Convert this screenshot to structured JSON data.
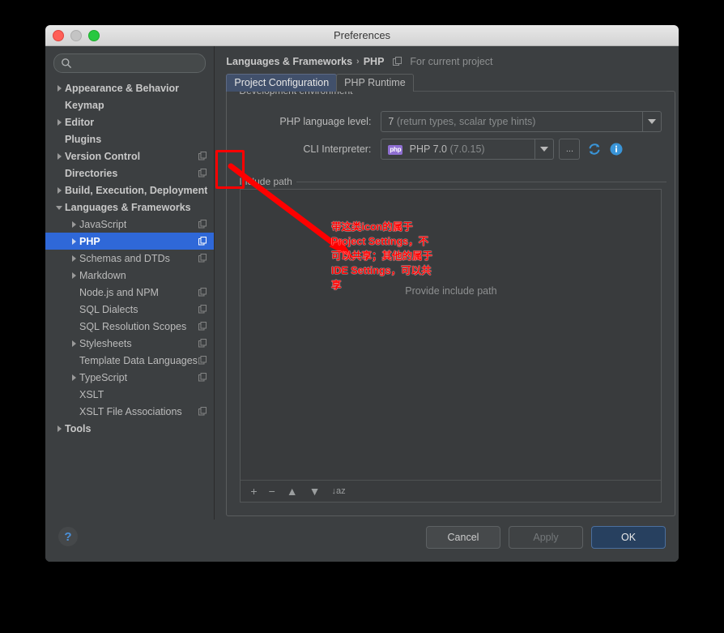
{
  "window": {
    "title": "Preferences",
    "traffic_lights": [
      "close-light",
      "minimize-light",
      "zoom-light"
    ]
  },
  "sidebar": {
    "search": {
      "value": "",
      "placeholder": ""
    },
    "items": [
      {
        "label": "Appearance & Behavior",
        "indent": 0,
        "arrow": "collapsed",
        "bold": true,
        "copy_icon": false,
        "selected": false
      },
      {
        "label": "Keymap",
        "indent": 0,
        "arrow": "none",
        "bold": true,
        "copy_icon": false,
        "selected": false
      },
      {
        "label": "Editor",
        "indent": 0,
        "arrow": "collapsed",
        "bold": true,
        "copy_icon": false,
        "selected": false
      },
      {
        "label": "Plugins",
        "indent": 0,
        "arrow": "none",
        "bold": true,
        "copy_icon": false,
        "selected": false
      },
      {
        "label": "Version Control",
        "indent": 0,
        "arrow": "collapsed",
        "bold": true,
        "copy_icon": true,
        "selected": false
      },
      {
        "label": "Directories",
        "indent": 0,
        "arrow": "none",
        "bold": true,
        "copy_icon": true,
        "selected": false
      },
      {
        "label": "Build, Execution, Deployment",
        "indent": 0,
        "arrow": "collapsed",
        "bold": true,
        "copy_icon": false,
        "selected": false
      },
      {
        "label": "Languages & Frameworks",
        "indent": 0,
        "arrow": "expanded",
        "bold": true,
        "copy_icon": false,
        "selected": false
      },
      {
        "label": "JavaScript",
        "indent": 1,
        "arrow": "collapsed",
        "bold": false,
        "copy_icon": true,
        "selected": false
      },
      {
        "label": "PHP",
        "indent": 1,
        "arrow": "collapsed",
        "bold": true,
        "copy_icon": true,
        "selected": true
      },
      {
        "label": "Schemas and DTDs",
        "indent": 1,
        "arrow": "collapsed",
        "bold": false,
        "copy_icon": true,
        "selected": false
      },
      {
        "label": "Markdown",
        "indent": 1,
        "arrow": "collapsed",
        "bold": false,
        "copy_icon": false,
        "selected": false
      },
      {
        "label": "Node.js and NPM",
        "indent": 1,
        "arrow": "none",
        "bold": false,
        "copy_icon": true,
        "selected": false
      },
      {
        "label": "SQL Dialects",
        "indent": 1,
        "arrow": "none",
        "bold": false,
        "copy_icon": true,
        "selected": false
      },
      {
        "label": "SQL Resolution Scopes",
        "indent": 1,
        "arrow": "none",
        "bold": false,
        "copy_icon": true,
        "selected": false
      },
      {
        "label": "Stylesheets",
        "indent": 1,
        "arrow": "collapsed",
        "bold": false,
        "copy_icon": true,
        "selected": false
      },
      {
        "label": "Template Data Languages",
        "indent": 1,
        "arrow": "none",
        "bold": false,
        "copy_icon": true,
        "selected": false
      },
      {
        "label": "TypeScript",
        "indent": 1,
        "arrow": "collapsed",
        "bold": false,
        "copy_icon": true,
        "selected": false
      },
      {
        "label": "XSLT",
        "indent": 1,
        "arrow": "none",
        "bold": false,
        "copy_icon": false,
        "selected": false
      },
      {
        "label": "XSLT File Associations",
        "indent": 1,
        "arrow": "none",
        "bold": false,
        "copy_icon": true,
        "selected": false
      },
      {
        "label": "Tools",
        "indent": 0,
        "arrow": "collapsed",
        "bold": true,
        "copy_icon": false,
        "selected": false
      }
    ]
  },
  "breadcrumb": {
    "parent": "Languages & Frameworks",
    "separator": "›",
    "current": "PHP",
    "scope_label": "For current project"
  },
  "tabs": [
    {
      "label": "Project Configuration",
      "active": true
    },
    {
      "label": "PHP Runtime",
      "active": false
    }
  ],
  "groups": {
    "development_environment": "Development environment",
    "include_path": "Include path"
  },
  "fields": {
    "language_level": {
      "label": "PHP language level:",
      "value_main": "7",
      "value_dim": "(return types, scalar type hints)"
    },
    "cli_interpreter": {
      "label": "CLI Interpreter:",
      "badge": "php",
      "value_main": "PHP 7.0",
      "value_dim": "(7.0.15)",
      "ellipsis_label": "...",
      "refresh_icon": "refresh-icon",
      "info_icon": "info-icon"
    }
  },
  "include_path": {
    "empty_hint": "Provide include path",
    "toolbar": [
      {
        "name": "add-button",
        "glyph": "+"
      },
      {
        "name": "remove-button",
        "glyph": "−"
      },
      {
        "name": "move-up-button",
        "glyph": "▲"
      },
      {
        "name": "move-down-button",
        "glyph": "▼"
      },
      {
        "name": "sort-button",
        "glyph": "↓az"
      }
    ]
  },
  "footer": {
    "help_label": "?",
    "cancel": "Cancel",
    "apply": "Apply",
    "ok": "OK"
  },
  "annotation": {
    "text": "带这类icon的属于Project Settings，不可以共享；其他的属于IDE Settings，可以共享",
    "color": "#fe0000"
  },
  "colors": {
    "selection_blue": "#2f68d8",
    "annotation_red": "#fe0000",
    "accent_blue": "#4a90d9",
    "php_badge": "#8f6fd2",
    "window_bg": "#3c3f41"
  }
}
